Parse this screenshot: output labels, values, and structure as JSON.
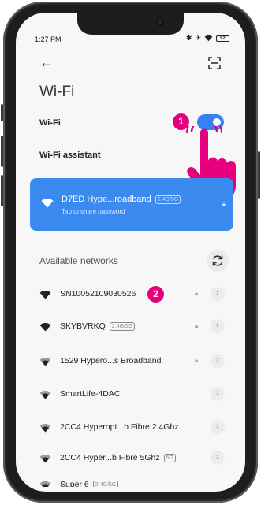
{
  "status_bar": {
    "time": "1:27 PM",
    "battery": "92"
  },
  "header": {
    "title": "Wi-Fi"
  },
  "wifi_toggle": {
    "label": "Wi-Fi",
    "on": true
  },
  "wifi_assistant": {
    "label": "Wi-Fi assistant"
  },
  "connected_network": {
    "name": "D7ED Hype...roadband",
    "band_tag": "2.4G/5G",
    "subtitle": "Tap to share password"
  },
  "available": {
    "title": "Available networks",
    "networks": [
      {
        "name": "SN10052109030526",
        "tag": "",
        "locked": true
      },
      {
        "name": "SKYBVRKQ",
        "tag": "2.4G/5G",
        "locked": true
      },
      {
        "name": "1529 Hypero...s Broadband",
        "tag": "",
        "locked": true
      },
      {
        "name": "SmartLife-4DAC",
        "tag": "",
        "locked": false
      },
      {
        "name": "2CC4 Hyperopt...b Fibre 2.4Ghz",
        "tag": "",
        "locked": false
      },
      {
        "name": "2CC4 Hyper...b Fibre 5Ghz",
        "tag": "5G",
        "locked": false
      },
      {
        "name": "Super 6",
        "tag": "2.4G/5G",
        "locked": false
      }
    ]
  },
  "annotations": {
    "step1": "1",
    "step2": "2"
  },
  "colors": {
    "accent": "#3482f6",
    "card": "#3b8af0",
    "badge": "#e6007e"
  },
  "icons": {
    "back": "arrow-left",
    "scan": "scan-frame",
    "refresh": "refresh",
    "wifi": "wifi-signal",
    "lock": "lock",
    "chevron": "chevron-right"
  }
}
